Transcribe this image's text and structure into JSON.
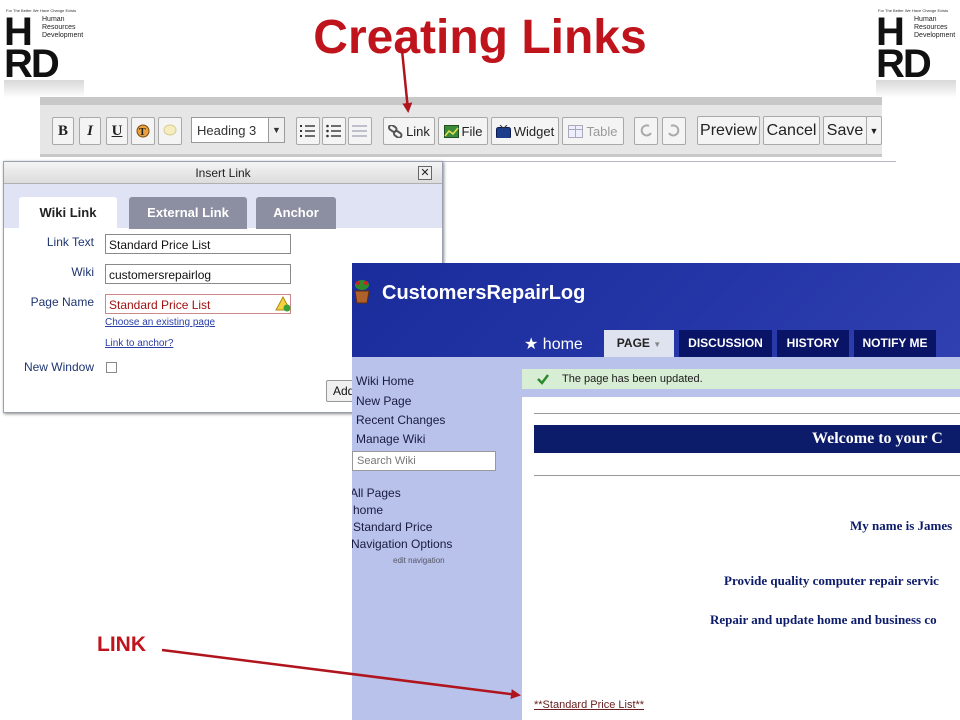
{
  "slide": {
    "title": "Creating Links",
    "callout_label": "LINK"
  },
  "logo": {
    "tagline": "For The Better We Have Change Exists",
    "line1": "Human",
    "line2": "Resources",
    "line3": "Development",
    "mark_top": "H",
    "mark_bottom": "RD"
  },
  "toolbar": {
    "bold": "B",
    "italic": "I",
    "underline": "U",
    "heading_value": "Heading 3",
    "link": "Link",
    "file": "File",
    "widget": "Widget",
    "table": "Table",
    "preview": "Preview",
    "cancel": "Cancel",
    "save": "Save"
  },
  "dialog": {
    "title": "Insert Link",
    "tabs": [
      "Wiki Link",
      "External Link",
      "Anchor"
    ],
    "link_text_label": "Link Text",
    "link_text_value": "Standard Price List",
    "wiki_label": "Wiki",
    "wiki_value": "customersrepairlog",
    "page_name_label": "Page Name",
    "page_name_value": "Standard Price List",
    "choose_existing": "Choose an existing page",
    "link_to_anchor": "Link to anchor?",
    "new_window_label": "New Window",
    "add_button": "Add"
  },
  "wiki": {
    "title": "CustomersRepairLog",
    "home": "home",
    "tabs": [
      "PAGE",
      "DISCUSSION",
      "HISTORY",
      "NOTIFY ME"
    ],
    "sidebar": [
      "Wiki Home",
      "New Page",
      "Recent Changes",
      "Manage Wiki"
    ],
    "search_placeholder": "Search Wiki",
    "nav": [
      "All Pages",
      "home",
      "Standard Price",
      "Navigation Options"
    ],
    "edit_navigation": "edit navigation",
    "message": "The page has been updated.",
    "welcome": "Welcome to your C",
    "line1": "My name is James",
    "line2": "Provide quality computer repair servic",
    "line3": "Repair and update home and business co",
    "price_link": "**Standard Price List**"
  },
  "colors": {
    "title_red": "#c0141c",
    "wiki_navy": "#0d1c6a",
    "wiki_header_blue": "#2536a8",
    "sidebar_lavender": "#b8c2ea"
  }
}
